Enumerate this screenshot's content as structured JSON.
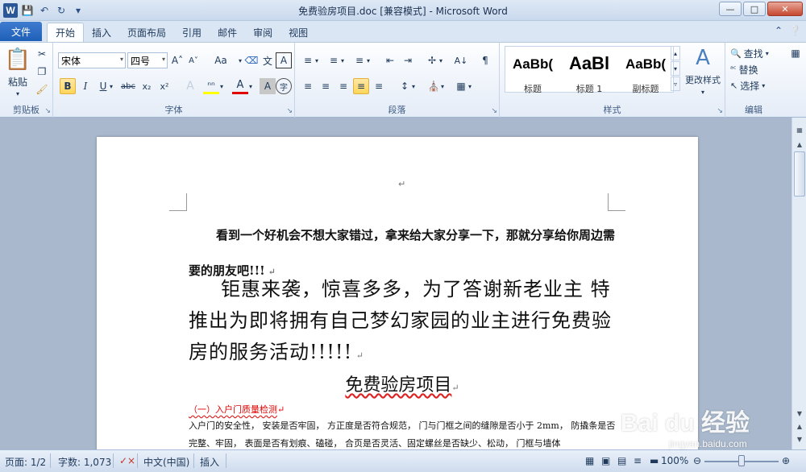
{
  "window": {
    "title": "免费验房项目.doc [兼容模式] - Microsoft Word",
    "app_icon": "W"
  },
  "tabs": {
    "file": "文件",
    "items": [
      "开始",
      "插入",
      "页面布局",
      "引用",
      "邮件",
      "审阅",
      "视图"
    ],
    "active": "开始"
  },
  "ribbon": {
    "clipboard": {
      "label": "剪贴板",
      "paste": "粘贴"
    },
    "font": {
      "label": "字体",
      "font_name": "宋体",
      "font_size": "四号",
      "case_btn": "Aa"
    },
    "paragraph": {
      "label": "段落"
    },
    "styles": {
      "label": "样式",
      "items": [
        {
          "sample": "AaBb(",
          "name": "标题"
        },
        {
          "sample": "AaBl",
          "name": "标题 1"
        },
        {
          "sample": "AaBb(",
          "name": "副标题"
        }
      ],
      "change": "更改样式"
    },
    "editing": {
      "label": "编辑",
      "find": "查找",
      "replace": "替换",
      "select": "选择"
    }
  },
  "document": {
    "para1": "看到一个好机会不想大家错过，拿来给大家分享一下，那就分享给你周边需要的朋友吧!!!",
    "para2": "钜惠来袭，惊喜多多，为了答谢新老业主 特推出为即将拥有自己梦幻家园的业主进行免费验房的服务活动!!!!!",
    "title": "免费验房项目",
    "section1_title": "（一）入户门质量检测",
    "body1": "入户门的安全性，  安装是否牢固，  方正度是否符合规范，  门与门框之间的缝隙是否小于 2mm，  防撬条是否完整、牢固，  表面是否有划痕、磕碰，  合页是否灵活、固定螺丝是否缺少、松动，  门框与墙体"
  },
  "statusbar": {
    "page": "页面: 1/2",
    "words": "字数: 1,073",
    "language": "中文(中国)",
    "mode": "插入",
    "zoom": "100%"
  },
  "watermark": {
    "brand": "Bai du 经验",
    "sub": "jingyan.baidu.com"
  }
}
